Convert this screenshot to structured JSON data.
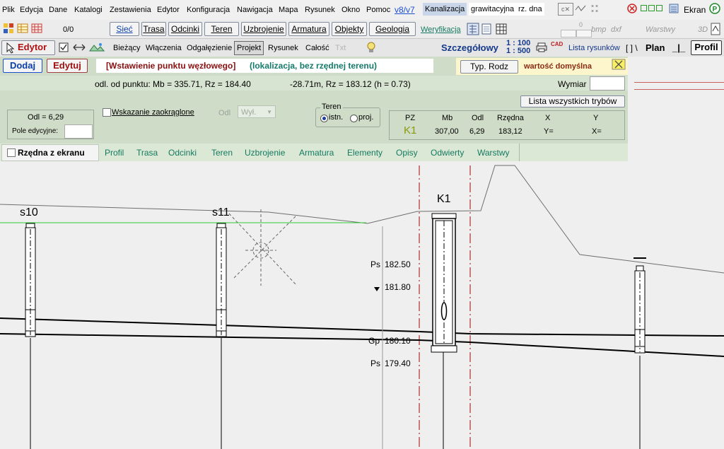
{
  "menu": {
    "items": [
      "Plik",
      "Edycja",
      "Dane",
      "Katalogi",
      "Zestawienia",
      "Edytor",
      "Konfiguracja",
      "Nawigacja",
      "Mapa",
      "Rysunek",
      "Okno",
      "Pomoc"
    ],
    "version_link": "v8/v7",
    "mode_tabs": [
      "Kanalizacja",
      "grawitacyjna",
      "rz. dna"
    ],
    "screen_label": "Ekran"
  },
  "toolbar2": {
    "counter": "0/0",
    "buttons": [
      "Sieć",
      "Trasa",
      "Odcinki",
      "Teren",
      "Uzbrojenie",
      "Armatura",
      "Objekty",
      "Geologia"
    ],
    "verification": "Weryfikacja",
    "bmp_label": "bmp",
    "dxf_label": "dxf",
    "layers_label": "Warstwy",
    "view3d_label": "3D",
    "stepper_value": "0"
  },
  "toolbar3": {
    "editor_label": "Edytor",
    "modes": [
      "Bieżący",
      "Włączenia",
      "Odgałęzienie",
      "Projekt",
      "Rysunek",
      "Całość",
      "Txt"
    ],
    "active_mode": "Projekt",
    "detail_label": "Szczegółowy",
    "scale_top": "1 : 100",
    "scale_bottom": "1 : 500",
    "cad_label": "CAD",
    "drawing_list": "Lista rysunków",
    "bracket_label": "[ ] \\",
    "plan_label": "Plan",
    "sep_label": "_|_",
    "profil_label": "Profil"
  },
  "panel": {
    "add_button": "Dodaj",
    "edit_button": "Edytuj",
    "banner_title": "[Wstawienie punktu węzłowego]",
    "banner_subtitle": "(lokalizacja, bez rzędnej terenu)",
    "type_button": "Typ. Rodz",
    "default_value": "wartość domyślna",
    "distance_text": "odl. od punktu:  Mb = 335.71,  Rz = 184.40",
    "offset_text": "-28.71m,  Rz = 183.12  (h = 0.73)",
    "dimension_label": "Wymiar",
    "dimension_value": "",
    "all_modes_button": "Lista wszystkich trybów",
    "odl_text": "Odl =  6,29",
    "edit_field_label": "Pole edycyjne:",
    "edit_field_value": "",
    "rounded_check": "Wskazanie zaokrąglone",
    "odl_small": "Odl",
    "odl_select": "Wył.",
    "terrain_group": "Teren",
    "radio_existing": "istn.",
    "radio_project": "proj.",
    "table_headers": [
      "PZ",
      "Mb",
      "Odl",
      "Rzędna",
      "X",
      "Y"
    ],
    "table_values": [
      "K1",
      "307,00",
      "6,29",
      "183,12",
      "Y=",
      "X="
    ],
    "screen_ordinate": "Rzędna z ekranu",
    "tabs": [
      "Profil",
      "Trasa",
      "Odcinki",
      "Teren",
      "Uzbrojenie",
      "Armatura",
      "Elementy",
      "Opisy",
      "Odwierty",
      "Warstwy"
    ]
  },
  "drawing": {
    "node_labels": [
      "s10",
      "s11",
      "K1"
    ],
    "annotations": [
      {
        "prefix": "Ps",
        "value": "182.50"
      },
      {
        "prefix": "",
        "value": "181.80"
      },
      {
        "prefix": "Gp",
        "value": "180.10"
      },
      {
        "prefix": "Ps",
        "value": "179.40"
      }
    ],
    "colors": {
      "terrain_line": "#6e6e6e",
      "green_line": "#31c831",
      "red_dash": "#b03030",
      "pipe": "#000000"
    }
  }
}
